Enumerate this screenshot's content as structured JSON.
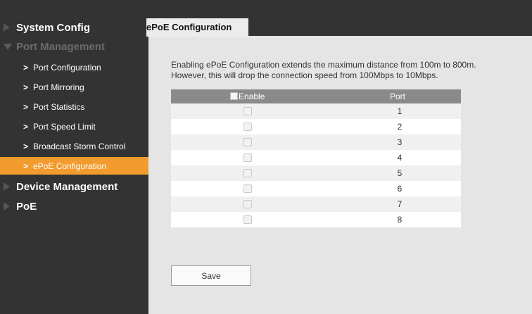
{
  "sidebar": {
    "groups": [
      {
        "label": "System Config"
      },
      {
        "label": "Port Management",
        "items": [
          {
            "label": "Port Configuration"
          },
          {
            "label": "Port Mirroring"
          },
          {
            "label": "Port Statistics"
          },
          {
            "label": "Port Speed Limit"
          },
          {
            "label": "Broadcast Storm Control"
          },
          {
            "label": "ePoE Configuration"
          }
        ]
      },
      {
        "label": "Device Management"
      },
      {
        "label": "PoE"
      }
    ]
  },
  "tab": {
    "label": "ePoE Configuration"
  },
  "description": {
    "line1": "Enabling ePoE Configuration extends the maximum distance from 100m to 800m.",
    "line2": "However, this will drop the connection speed from 100Mbps to 10Mbps."
  },
  "table": {
    "headers": {
      "enable": "Enable",
      "port": "Port"
    },
    "rows": [
      {
        "port": "1",
        "enabled": false
      },
      {
        "port": "2",
        "enabled": false
      },
      {
        "port": "3",
        "enabled": false
      },
      {
        "port": "4",
        "enabled": false
      },
      {
        "port": "5",
        "enabled": false
      },
      {
        "port": "6",
        "enabled": false
      },
      {
        "port": "7",
        "enabled": false
      },
      {
        "port": "8",
        "enabled": false
      }
    ]
  },
  "actions": {
    "save_label": "Save"
  },
  "colors": {
    "sidebar_bg": "#333333",
    "active_item": "#f29b2e",
    "header_row": "#8a8a8a"
  }
}
